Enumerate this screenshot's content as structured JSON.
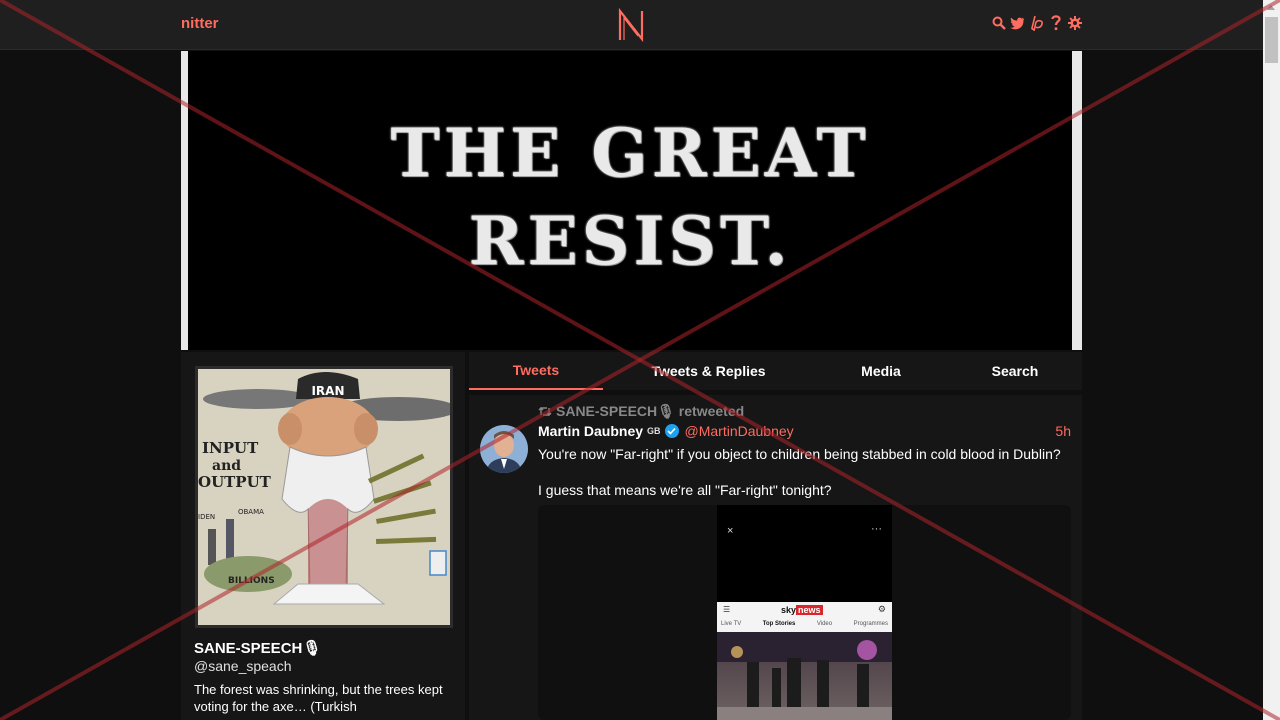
{
  "nav": {
    "brand": "nitter",
    "logo_letter": "N",
    "icons": [
      "search-icon",
      "twitter-icon",
      "liberapay-icon",
      "help-icon",
      "gear-icon"
    ]
  },
  "banner": {
    "line1": "THE GREAT",
    "line2": "RESIST."
  },
  "profile": {
    "avatar_labels": {
      "hat": "IRAN",
      "sign": "INPUT and OUTPUT",
      "obama": "OBAMA",
      "biden": "IDEN",
      "money": "BILLIONS"
    },
    "fullname": "SANE-SPEECH🎙",
    "username": "@sane_speach",
    "bio": "The forest was shrinking, but the trees kept voting for the axe… (Turkish"
  },
  "tabs": [
    "Tweets",
    "Tweets & Replies",
    "Media",
    "Search"
  ],
  "tweet": {
    "retweeted_by": "SANE-SPEECH🎙 retweeted",
    "fullname": "Martin Daubney",
    "flag": "GB",
    "username": "@MartinDaubney",
    "date": "5h",
    "paragraphs": [
      "You're now \"Far-right\" if you object to children being stabbed in cold blood in Dublin?",
      "I guess that means we're all \"Far-right\" tonight?"
    ],
    "media": {
      "close": "×",
      "more": "···",
      "app_logo_sky": "sky",
      "app_logo_news": "news",
      "app_tabs": [
        "Live TV",
        "Top Stories",
        "Video",
        "Programmes"
      ]
    }
  },
  "colors": {
    "accent": "#ff6c60",
    "background": "#0f0f0f",
    "panel": "#161616",
    "overlay_x": "#b0242a"
  }
}
